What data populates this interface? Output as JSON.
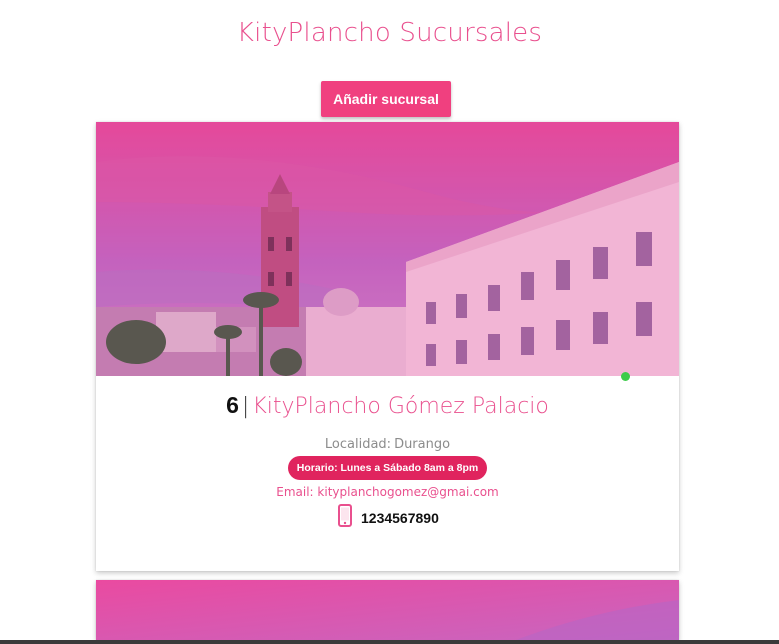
{
  "header": {
    "title": "KityPlancho Sucursales"
  },
  "toolbar": {
    "add_label": "Añadir sucursal"
  },
  "branches": [
    {
      "id": "6",
      "separator": "|",
      "name": "KityPlancho Gómez Palacio",
      "locality_label": "Localidad:",
      "locality": "Durango",
      "schedule": "Horario: Lunes a Sábado 8am a 8pm",
      "email_label": "Email:",
      "email": "kityplanchogomez@gmai.com",
      "phone": "1234567890",
      "status_color": "#3dcc4a"
    }
  ],
  "icons": {
    "phone": "smartphone-icon",
    "status": "online-status-dot"
  },
  "colors": {
    "accent": "#e9508e",
    "button": "#f0407f",
    "badge": "#e0245e"
  }
}
